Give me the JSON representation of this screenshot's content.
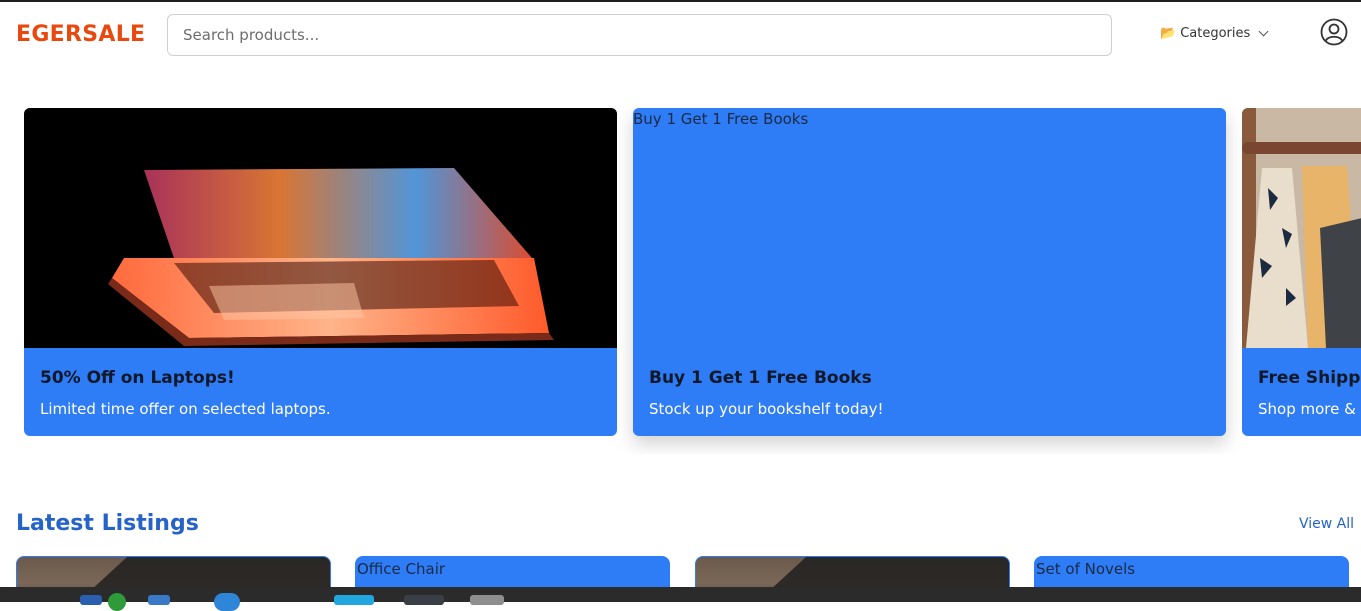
{
  "header": {
    "logo": "EGERSALE",
    "search_placeholder": "Search products...",
    "categories_label": "Categories",
    "categories_icon": "📂"
  },
  "banners": [
    {
      "alt": "",
      "title": "50% Off on Laptops!",
      "subtitle": "Limited time offer on selected laptops.",
      "image": "laptop-photo"
    },
    {
      "alt": "Buy 1 Get 1 Free Books",
      "title": "Buy 1 Get 1 Free Books",
      "subtitle": "Stock up your bookshelf today!",
      "image": "broken-image"
    },
    {
      "alt": "",
      "title": "Free Shippi",
      "subtitle": "Shop more &",
      "image": "clothes-rack-photo"
    }
  ],
  "latest": {
    "title": "Latest Listings",
    "view_all": "View All",
    "cards": [
      {
        "alt": "",
        "image": "desk-photo"
      },
      {
        "alt": "Office Chair",
        "image": "broken-image"
      },
      {
        "alt": "",
        "image": "desk-photo"
      },
      {
        "alt": "Set of Novels",
        "image": "broken-image"
      }
    ]
  },
  "colors": {
    "brand": "#e8490f",
    "accent": "#2e7cf6",
    "link": "#2563c9"
  }
}
